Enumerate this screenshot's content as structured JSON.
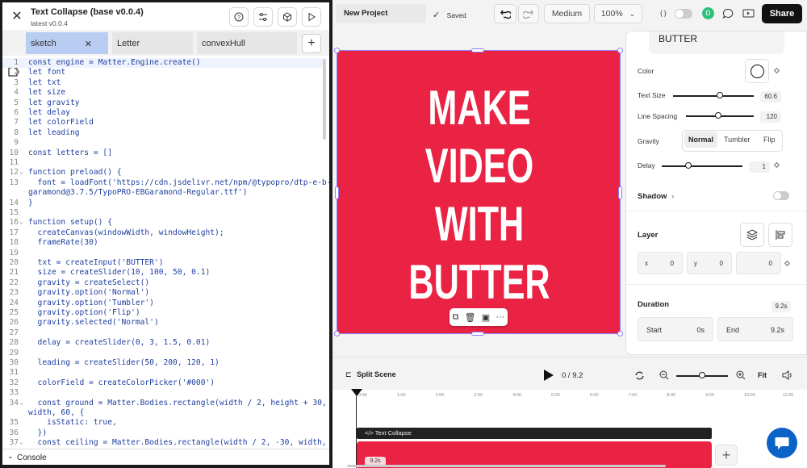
{
  "editor": {
    "title": "Text Collapse (base v0.0.4)",
    "subtitle": "latest v0.0.4",
    "tabs": [
      {
        "label": "sketch"
      },
      {
        "label": "Letter"
      },
      {
        "label": "convexHull"
      }
    ],
    "plus": "+",
    "console_label": "Console",
    "lines": [
      {
        "n": "1",
        "t": "const engine = Matter.Engine.create()"
      },
      {
        "n": "2",
        "t": "let font"
      },
      {
        "n": "3",
        "t": "let txt"
      },
      {
        "n": "4",
        "t": "let size"
      },
      {
        "n": "5",
        "t": "let gravity"
      },
      {
        "n": "6",
        "t": "let delay"
      },
      {
        "n": "7",
        "t": "let colorField"
      },
      {
        "n": "8",
        "t": "let leading"
      },
      {
        "n": "9",
        "t": ""
      },
      {
        "n": "10",
        "t": "const letters = []"
      },
      {
        "n": "11",
        "t": ""
      },
      {
        "n": "12",
        "t": "function preload() {"
      },
      {
        "n": "13",
        "t": "  font = loadFont('https://cdn.jsdelivr.net/npm/@typopro/dtp-e-b-"
      },
      {
        "n": "",
        "t": "garamond@3.7.5/TypoPRO-EBGaramond-Regular.ttf')"
      },
      {
        "n": "14",
        "t": "}"
      },
      {
        "n": "15",
        "t": ""
      },
      {
        "n": "16",
        "t": "function setup() {"
      },
      {
        "n": "17",
        "t": "  createCanvas(windowWidth, windowHeight);"
      },
      {
        "n": "18",
        "t": "  frameRate(30)"
      },
      {
        "n": "19",
        "t": ""
      },
      {
        "n": "20",
        "t": "  txt = createInput('BUTTER')"
      },
      {
        "n": "21",
        "t": "  size = createSlider(10, 100, 50, 0.1)"
      },
      {
        "n": "22",
        "t": "  gravity = createSelect()"
      },
      {
        "n": "23",
        "t": "  gravity.option('Normal')"
      },
      {
        "n": "24",
        "t": "  gravity.option('Tumbler')"
      },
      {
        "n": "25",
        "t": "  gravity.option('Flip')"
      },
      {
        "n": "26",
        "t": "  gravity.selected('Normal')"
      },
      {
        "n": "27",
        "t": ""
      },
      {
        "n": "28",
        "t": "  delay = createSlider(0, 3, 1.5, 0.01)"
      },
      {
        "n": "29",
        "t": ""
      },
      {
        "n": "30",
        "t": "  leading = createSlider(50, 200, 120, 1)"
      },
      {
        "n": "31",
        "t": ""
      },
      {
        "n": "32",
        "t": "  colorField = createColorPicker('#000')"
      },
      {
        "n": "33",
        "t": ""
      },
      {
        "n": "34",
        "t": "  const ground = Matter.Bodies.rectangle(width / 2, height + 30,"
      },
      {
        "n": "",
        "t": "width, 60, {"
      },
      {
        "n": "35",
        "t": "    isStatic: true,"
      },
      {
        "n": "36",
        "t": "  })"
      },
      {
        "n": "37",
        "t": "  const ceiling = Matter.Bodies.rectangle(width / 2, -30, width,"
      }
    ]
  },
  "app": {
    "project_name": "New Project",
    "saved": "Saved",
    "quality": "Medium",
    "zoom": "100%",
    "braces": "{ }",
    "avatar_initial": "D",
    "share": "Share",
    "stage_lines": [
      "MAKE",
      "VIDEO",
      "WITH",
      "BUTTER"
    ],
    "stage_color": "#ea2344",
    "stage_tools_more": "···",
    "panel": {
      "text_value": "BUTTER",
      "color_label": "Color",
      "text_size_label": "Text Size",
      "text_size_value": "60.6",
      "text_size_frac": 0.58,
      "line_spacing_label": "Line Spacing",
      "line_spacing_value": "120",
      "line_spacing_frac": 0.48,
      "gravity_label": "Gravity",
      "gravity_options": [
        "Normal",
        "Tumbler",
        "Flip"
      ],
      "delay_label": "Delay",
      "delay_value": "1",
      "delay_frac": 0.33,
      "shadow_label": "Shadow",
      "layer_label": "Layer",
      "x_label": "x",
      "x_value": "0",
      "y_label": "y",
      "y_value": "0",
      "r_value": "0",
      "duration_label": "Duration",
      "duration_value": "9.2s",
      "start_label": "Start",
      "start_value": "0s",
      "end_label": "End",
      "end_value": "9.2s"
    },
    "timeline": {
      "split_scene": "Split Scene",
      "time": "0 / 9.2",
      "fit": "Fit",
      "ticks": [
        "0:00",
        "1:00",
        "2:00",
        "3:00",
        "4:00",
        "5:00",
        "6:00",
        "7:00",
        "8:00",
        "9:00",
        "10:00",
        "11:00"
      ],
      "clip_label": "</> Text Collapse",
      "clip_duration": "9.2s",
      "add": "+"
    }
  }
}
